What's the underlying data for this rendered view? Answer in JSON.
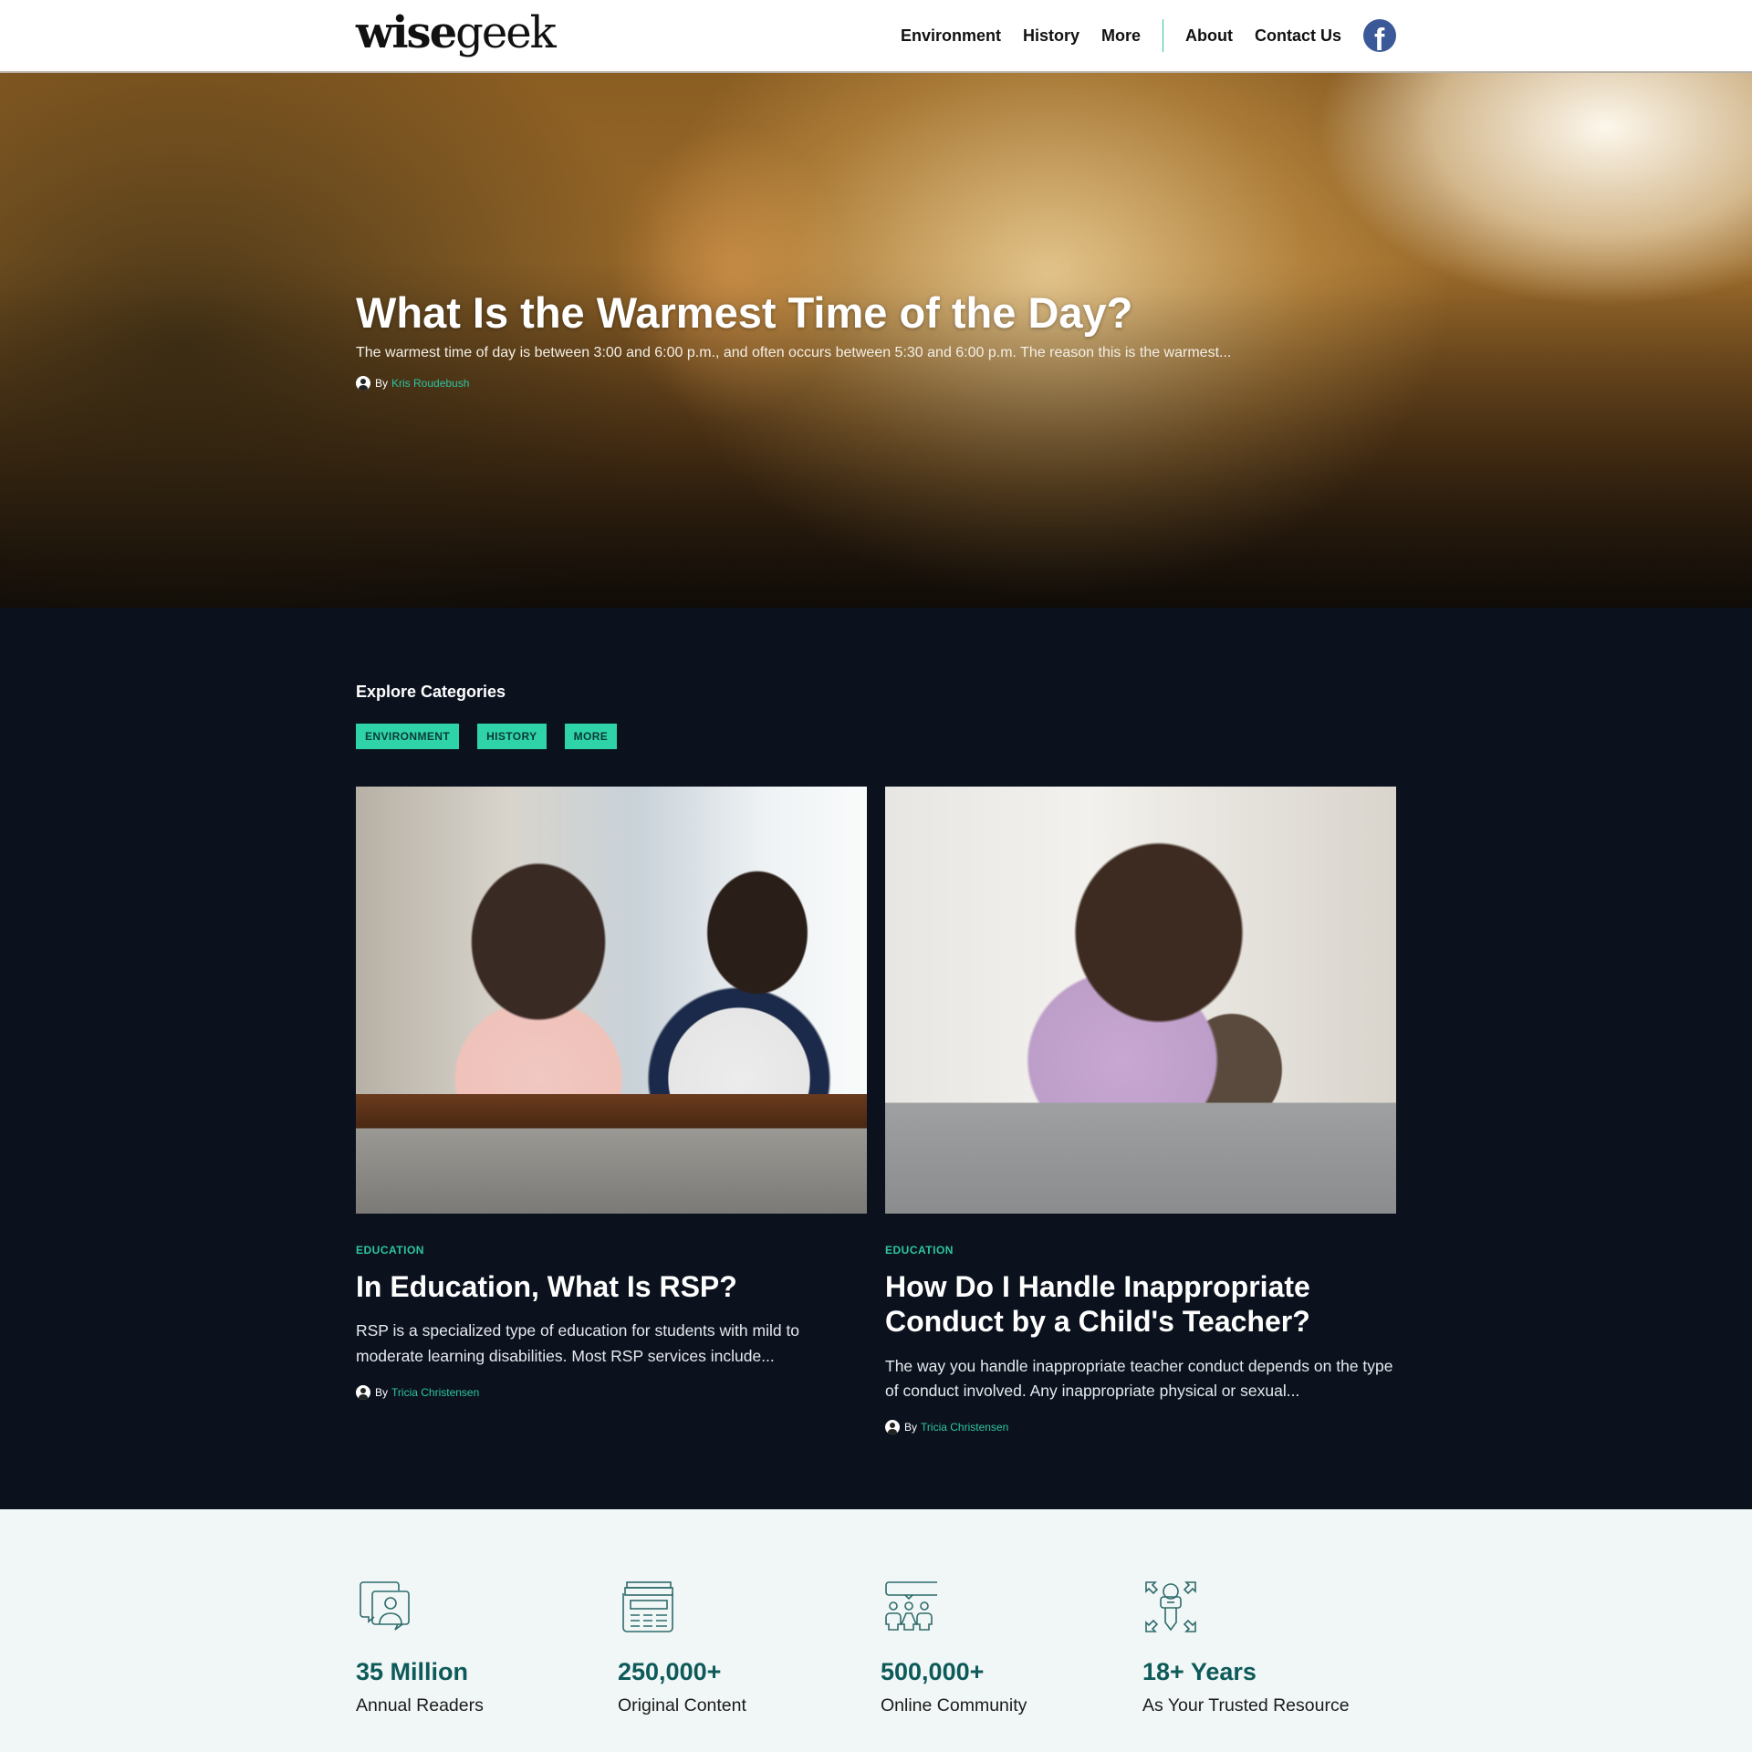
{
  "header": {
    "logo": {
      "part1": "wise",
      "part2": "geek"
    },
    "nav": [
      {
        "label": "Environment"
      },
      {
        "label": "History"
      },
      {
        "label": "More"
      }
    ],
    "secondary_nav": [
      {
        "label": "About"
      },
      {
        "label": "Contact Us"
      }
    ],
    "social": {
      "icon": "facebook-icon",
      "glyph": "f",
      "color": "#3b5998"
    }
  },
  "hero": {
    "title": "What Is the Warmest Time of the Day?",
    "excerpt": "The warmest time of day is between 3:00 and 6:00 p.m., and often occurs between 5:30 and 6:00 p.m. The reason this is the warmest...",
    "by": "By",
    "author": "Kris Roudebush"
  },
  "explore": {
    "heading": "Explore Categories",
    "chips": [
      {
        "label": "ENVIRONMENT"
      },
      {
        "label": "HISTORY"
      },
      {
        "label": "MORE"
      }
    ]
  },
  "articles": [
    {
      "category": "EDUCATION",
      "title": "In Education, What Is RSP?",
      "excerpt": "RSP is a specialized type of education for students with mild to moderate learning disabilities. Most RSP services include...",
      "by": "By",
      "author": "Tricia Christensen",
      "image_alt": "Teacher reading a book with a student at a library table"
    },
    {
      "category": "EDUCATION",
      "title": "How Do I Handle Inappropriate Conduct by a Child's Teacher?",
      "excerpt": "The way you handle inappropriate teacher conduct depends on the type of conduct involved. Any inappropriate physical or sexual...",
      "by": "By",
      "author": "Tricia Christensen",
      "image_alt": "Mother comforting a child on a sofa"
    }
  ],
  "stats": [
    {
      "icon": "chat-user-icon",
      "value": "35 Million",
      "label": "Annual Readers"
    },
    {
      "icon": "newspaper-icon",
      "value": "250,000+",
      "label": "Original Content"
    },
    {
      "icon": "community-icon",
      "value": "500,000+",
      "label": "Online Community"
    },
    {
      "icon": "microphone-expand-icon",
      "value": "18+ Years",
      "label": "As Your Trusted Resource"
    }
  ],
  "colors": {
    "accent": "#2ec4a1",
    "chip_bg": "#2ed3a8",
    "dark_bg": "#0b121e",
    "stats_bg": "#f1f7f6",
    "stat_value": "#0e5a5a"
  }
}
